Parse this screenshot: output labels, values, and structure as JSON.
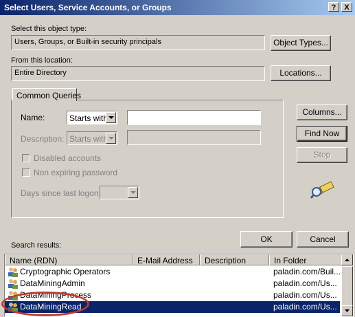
{
  "window": {
    "title": "Select Users, Service Accounts, or Groups",
    "help_btn": "?",
    "close_btn": "X"
  },
  "object_type": {
    "label": "Select this object type:",
    "value": "Users, Groups, or Built-in security principals",
    "button": "Object Types..."
  },
  "location": {
    "label": "From this location:",
    "value": "Entire Directory",
    "button": "Locations..."
  },
  "queries": {
    "tab": "Common Queries",
    "name_label": "Name:",
    "name_mode": "Starts with",
    "name_value": "",
    "description_label": "Description:",
    "description_mode": "Starts with",
    "description_value": "",
    "disabled_accounts": "Disabled accounts",
    "non_expiring": "Non expiring password",
    "days_label": "Days since last logon:",
    "days_value": ""
  },
  "side_buttons": {
    "columns": "Columns...",
    "find_now": "Find Now",
    "stop": "Stop"
  },
  "dialog_buttons": {
    "ok": "OK",
    "cancel": "Cancel"
  },
  "results": {
    "label": "Search results:",
    "columns": [
      "Name (RDN)",
      "E-Mail Address",
      "Description",
      "In Folder"
    ],
    "rows": [
      {
        "name": "Cryptographic Operators",
        "email": "",
        "description": "",
        "folder": "paladin.com/Buil..."
      },
      {
        "name": "DataMiningAdmin",
        "email": "",
        "description": "",
        "folder": "paladin.com/Us..."
      },
      {
        "name": "DataMiningProcess",
        "email": "",
        "description": "",
        "folder": "paladin.com/Us..."
      },
      {
        "name": "DataMiningRead",
        "email": "",
        "description": "",
        "folder": "paladin.com/Us...",
        "selected": true
      }
    ]
  },
  "colors": {
    "title_start": "#0a246a",
    "title_end": "#a6caf0",
    "selection": "#0a246a",
    "highlight_circle": "#c0392b"
  },
  "icons": [
    "help-icon",
    "close-icon",
    "user-group-icon",
    "search-flashlight-icon"
  ]
}
